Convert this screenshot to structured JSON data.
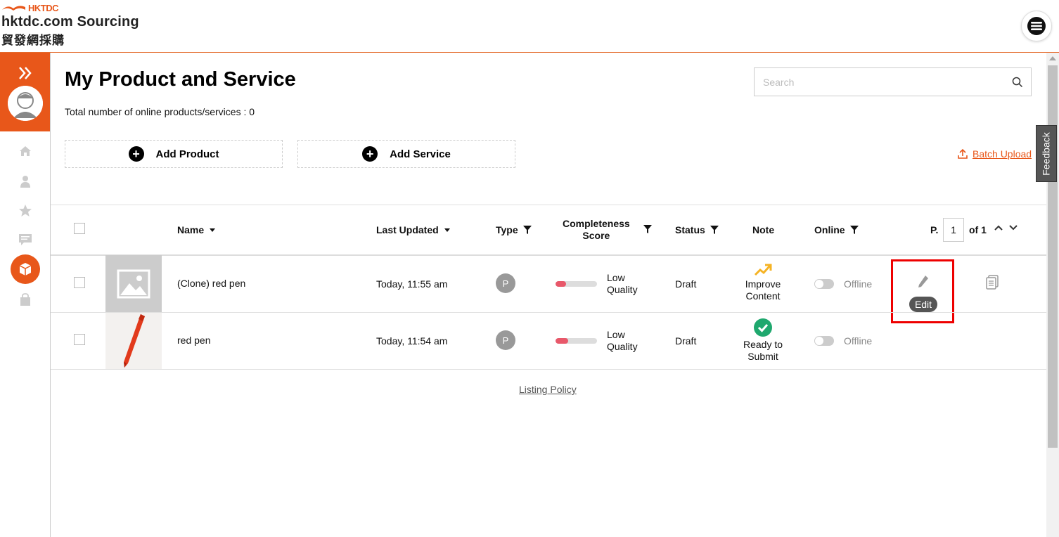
{
  "header": {
    "logo_top": "HKTDC",
    "logo_main": "hktdc.com Sourcing",
    "logo_cn": "貿發網採購"
  },
  "page": {
    "title": "My Product and Service",
    "total_text": "Total number of online products/services : 0",
    "search_placeholder": "Search",
    "add_product": "Add Product",
    "add_service": "Add Service",
    "batch_upload": "Batch Upload",
    "feedback": "Feedback",
    "listing_policy": "Listing Policy"
  },
  "table": {
    "headers": {
      "name": "Name",
      "last_updated": "Last Updated",
      "type": "Type",
      "completeness_1": "Completeness",
      "completeness_2": "Score",
      "status": "Status",
      "note": "Note",
      "online": "Online"
    },
    "pager": {
      "label": "P.",
      "current": "1",
      "of": "of 1"
    },
    "rows": [
      {
        "name": "(Clone) red pen",
        "updated": "Today, 11:55 am",
        "type": "P",
        "score_1": "Low",
        "score_2": "Quality",
        "score_fraction": 0.25,
        "status": "Draft",
        "note_1": "Improve",
        "note_2": "Content",
        "online": "Offline"
      },
      {
        "name": "red pen",
        "updated": "Today, 11:54 am",
        "type": "P",
        "score_1": "Low",
        "score_2": "Quality",
        "score_fraction": 0.3,
        "status": "Draft",
        "note_1": "Ready to",
        "note_2": "Submit",
        "online": "Offline"
      }
    ],
    "edit_tooltip": "Edit"
  },
  "colors": {
    "brand_orange": "#e8571a",
    "score_red": "#e8586a",
    "ready_green": "#1fa86e",
    "improve_yellow": "#f5b324"
  }
}
